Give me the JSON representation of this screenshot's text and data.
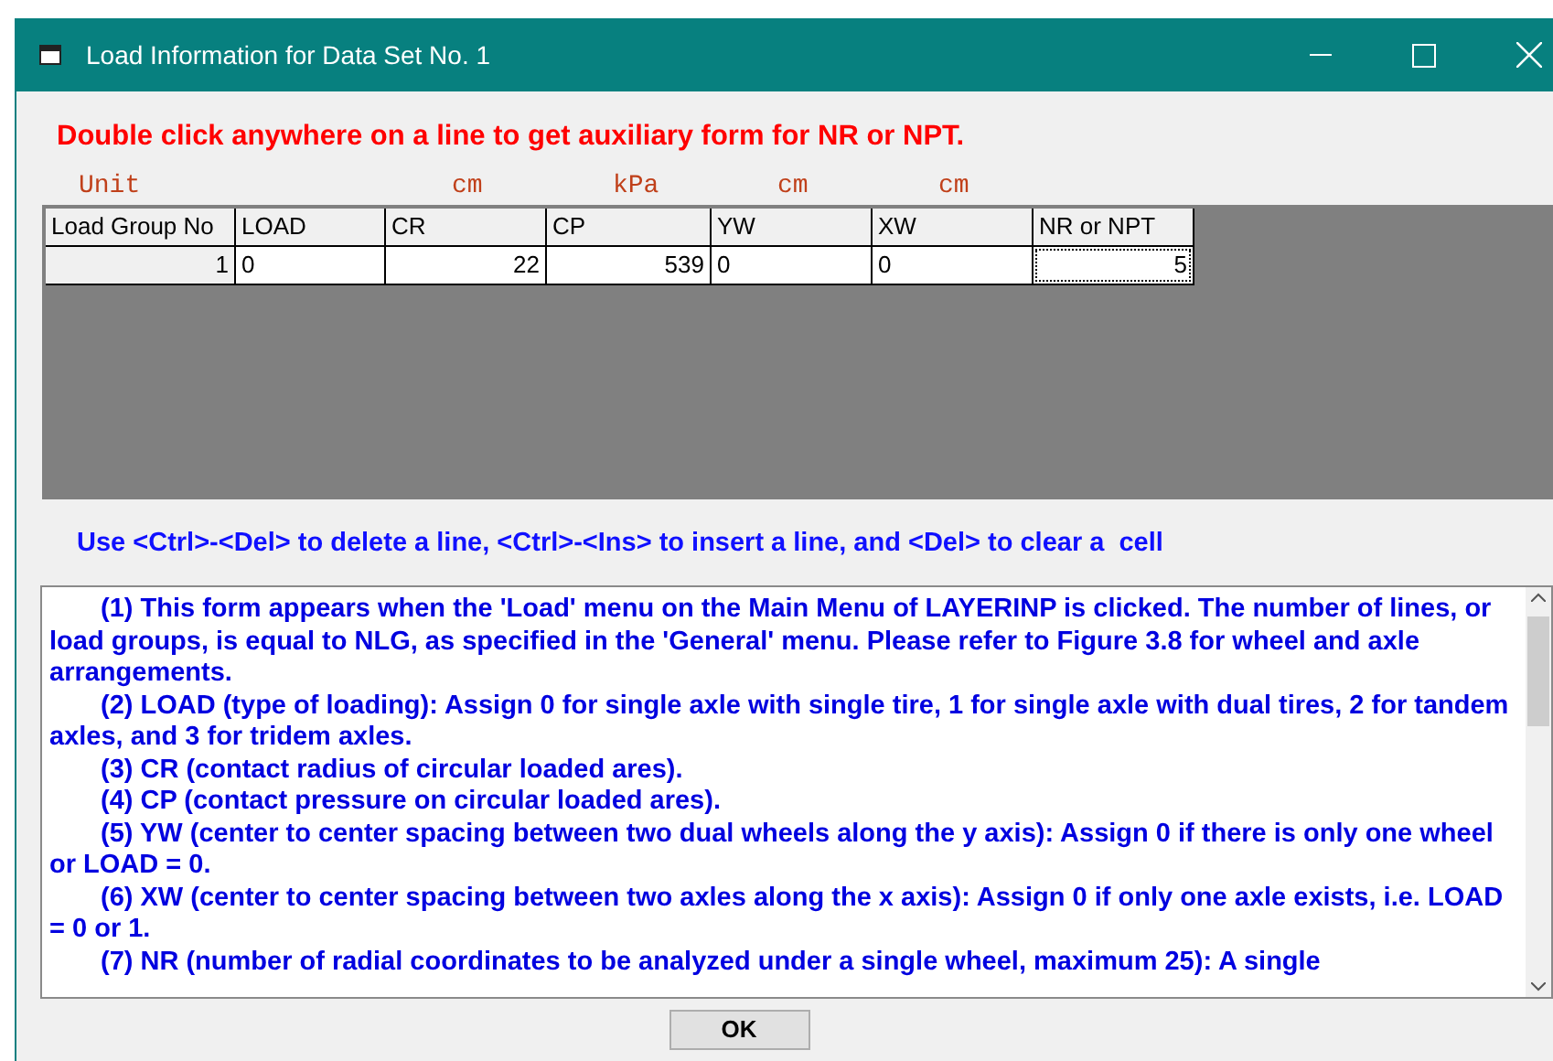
{
  "window": {
    "title": "Load Information for Data Set No. 1"
  },
  "instruction": "Double click anywhere on a line to get auxiliary form for NR or NPT.",
  "unit_label": "Unit",
  "table": {
    "columns": [
      {
        "label": "Load Group No"
      },
      {
        "label": "LOAD"
      },
      {
        "label": "CR",
        "unit": "cm"
      },
      {
        "label": "CP",
        "unit": "kPa"
      },
      {
        "label": "YW",
        "unit": "cm"
      },
      {
        "label": "XW",
        "unit": "cm"
      },
      {
        "label": "NR or NPT"
      }
    ],
    "rows": [
      {
        "cells": [
          {
            "text": "1",
            "kind": "number",
            "focused": false
          },
          {
            "text": "0",
            "kind": "text",
            "focused": false
          },
          {
            "text": "22",
            "kind": "number",
            "focused": false
          },
          {
            "text": "539",
            "kind": "number",
            "focused": false
          },
          {
            "text": "0",
            "kind": "text",
            "focused": false
          },
          {
            "text": "0",
            "kind": "text",
            "focused": false
          },
          {
            "text": "5",
            "kind": "number",
            "focused": true
          }
        ]
      }
    ]
  },
  "hint": "Use <Ctrl>-<Del> to delete a line, <Ctrl>-<Ins> to insert a line, and <Del> to clear a  cell",
  "help_items": [
    "(1)  This form appears when the 'Load' menu on the Main Menu of LAYERINP is clicked.  The number of lines, or load groups, is equal to NLG, as specified in the 'General' menu.  Please refer to Figure 3.8 for wheel and axle arrangements.",
    "(2)  LOAD (type of loading): Assign 0 for single axle with single tire, 1 for single axle with dual tires, 2 for tandem axles, and 3 for tridem axles.",
    "(3)  CR (contact radius of circular loaded ares).",
    "(4)  CP (contact pressure on circular loaded ares).",
    "(5)  YW (center to center spacing between two dual wheels along the y axis): Assign 0 if there is only one wheel or LOAD = 0.",
    "(6)  XW (center to center spacing between two axles along the x axis): Assign 0 if only one axle exists, i.e. LOAD = 0 or 1.",
    "(7)  NR (number of radial coordinates to be analyzed under a single wheel, maximum 25): A single"
  ],
  "ok_button": "OK"
}
